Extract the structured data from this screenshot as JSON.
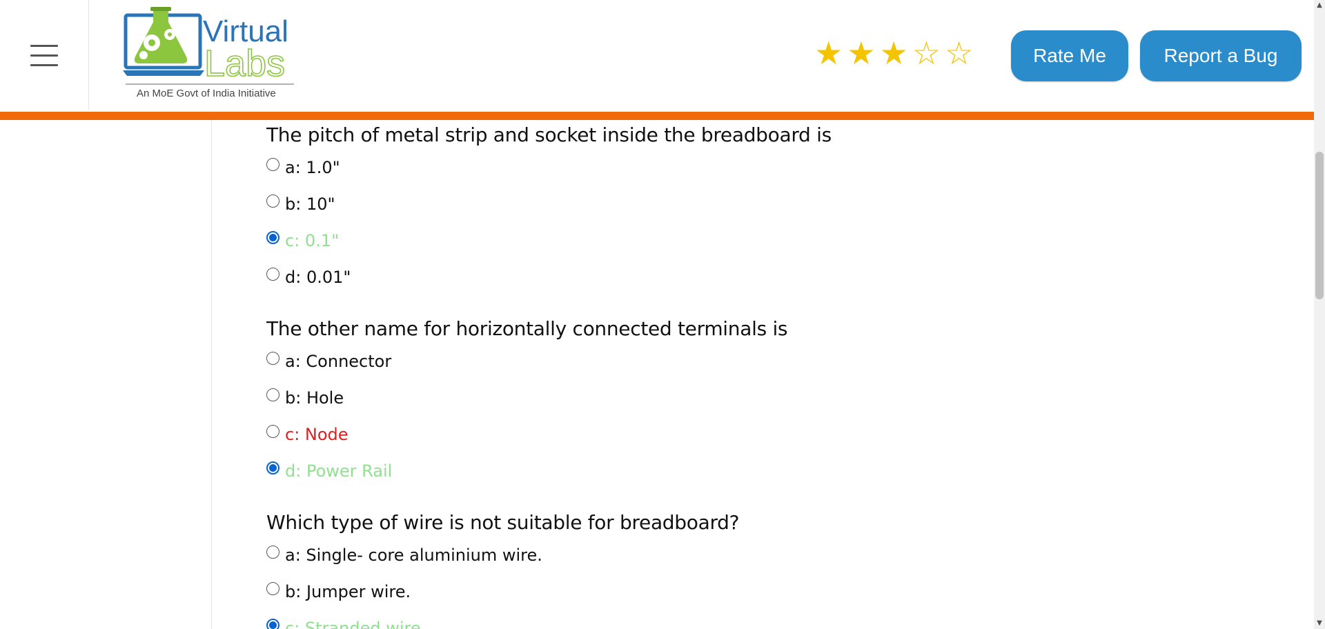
{
  "header": {
    "menu_icon": "hamburger-menu-icon",
    "logo": {
      "line1": "Virtual",
      "line2": "Labs",
      "tagline": "An MoE Govt of India Initiative",
      "colors": {
        "blue": "#2a74b8",
        "green": "#8cc63f",
        "flask": "#8cc63f"
      }
    },
    "rating": {
      "value": 3,
      "max": 5,
      "filled_symbol": "★",
      "empty_symbol": "☆",
      "color": "#f5c400"
    },
    "rate_label": "Rate Me",
    "bug_label": "Report a Bug",
    "accent_color": "#f06a0c",
    "button_color": "#2a8ccb"
  },
  "questions": [
    {
      "text": "The pitch of metal strip and socket inside the breadboard is",
      "options": [
        {
          "label": "a: 1.0\"",
          "checked": false,
          "status": "neutral"
        },
        {
          "label": "b: 10\"",
          "checked": false,
          "status": "neutral"
        },
        {
          "label": "c: 0.1\"",
          "checked": true,
          "status": "correct"
        },
        {
          "label": "d: 0.01\"",
          "checked": false,
          "status": "neutral"
        }
      ]
    },
    {
      "text": "The other name for horizontally connected terminals is",
      "options": [
        {
          "label": "a: Connector",
          "checked": false,
          "status": "neutral"
        },
        {
          "label": "b: Hole",
          "checked": false,
          "status": "neutral"
        },
        {
          "label": "c: Node",
          "checked": false,
          "status": "wrong"
        },
        {
          "label": "d: Power Rail",
          "checked": true,
          "status": "correct"
        }
      ]
    },
    {
      "text": "Which type of wire is not suitable for breadboard?",
      "options": [
        {
          "label": "a: Single- core aluminium wire.",
          "checked": false,
          "status": "neutral"
        },
        {
          "label": "b: Jumper wire.",
          "checked": false,
          "status": "neutral"
        },
        {
          "label": "c: Stranded wire",
          "checked": true,
          "status": "correct"
        }
      ]
    }
  ],
  "colors": {
    "correct": "#90e090",
    "wrong": "#e02020",
    "radio_checked": "#0a62d0"
  }
}
